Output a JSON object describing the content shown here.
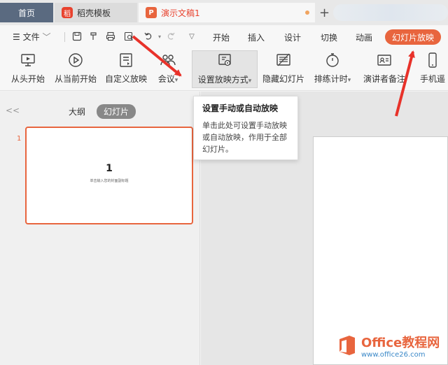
{
  "tabs": {
    "home": "首页",
    "template": "稻壳模板",
    "document": "演示文稿1",
    "template_logo": "稻",
    "document_logo": "P",
    "add": "+"
  },
  "menu": {
    "file_label": "文件",
    "tabs": [
      "开始",
      "插入",
      "设计",
      "切换",
      "动画",
      "幻灯片放映"
    ],
    "active_tab": "幻灯片放映"
  },
  "ribbon": {
    "buttons": [
      {
        "label": "从头开始",
        "icon": "monitor-play-icon"
      },
      {
        "label": "从当前开始",
        "icon": "play-circle-icon"
      },
      {
        "label": "自定义放映",
        "icon": "custom-show-icon"
      },
      {
        "label": "会议",
        "icon": "meeting-icon"
      },
      {
        "label": "设置放映方式",
        "icon": "setup-show-icon"
      },
      {
        "label": "隐藏幻灯片",
        "icon": "hide-slide-icon"
      },
      {
        "label": "排练计时",
        "icon": "stopwatch-icon"
      },
      {
        "label": "演讲者备注",
        "icon": "speaker-notes-icon"
      },
      {
        "label": "手机遥",
        "icon": "phone-remote-icon"
      }
    ],
    "dropdown_marker": "▾"
  },
  "tooltip": {
    "title": "设置手动或自动放映",
    "body": "单击此处可设置手动放映或自动放映，作用于全部幻灯片。"
  },
  "leftpanel": {
    "collapse": "<<",
    "outline_tab": "大纲",
    "slides_tab": "幻灯片",
    "slide_number": "1",
    "slide_title": "1",
    "slide_subtitle": "单击输入您的封面副标题"
  },
  "watermark": {
    "title": "Office教程网",
    "url": "www.office26.com"
  },
  "colors": {
    "accent": "#e8653e",
    "arrow": "#e8322a",
    "home_tab": "#5a6a80"
  }
}
